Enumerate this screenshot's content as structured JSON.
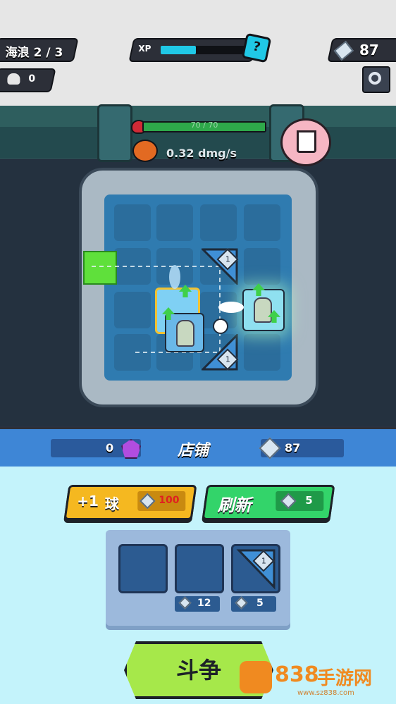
{
  "hud": {
    "wave_label": "海浪 2 / 3",
    "xp_label": "XP",
    "xp_fill": 0.42,
    "help_icon_text": "?",
    "gem_count": "87",
    "kill_count": "0"
  },
  "enemy": {
    "hp_text": "70 / 70",
    "dps_text": "0.32 dmg/s"
  },
  "board": {
    "triangle_top_label": "1",
    "triangle_bottom_label": "1"
  },
  "shop": {
    "title": "店铺",
    "purple_gem_count": "0",
    "gem_count": "87",
    "add_ball_label": "+1",
    "add_ball_unit": "球",
    "add_ball_cost": "100",
    "refresh_label": "刷新",
    "refresh_cost": "5",
    "slots": [
      {
        "price": ""
      },
      {
        "price": "12"
      },
      {
        "price": "5",
        "item_label": "1"
      }
    ],
    "fight_label": "斗争"
  },
  "watermark": {
    "brand_number": "838",
    "brand_text": "手游网",
    "url": "www.sz838.com"
  },
  "colors": {
    "yellow_button": "#f5b820",
    "green_button": "#33d46a",
    "shop_band": "#3e86d6",
    "bottom_bg": "#c4f3fb",
    "xp_bar": "#20c8e6"
  }
}
